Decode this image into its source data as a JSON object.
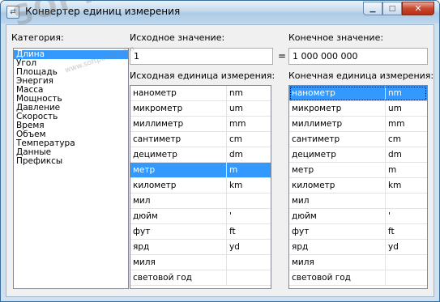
{
  "window": {
    "title": "Конвертер единиц измерения",
    "icon": "converter-app-icon",
    "minimize_glyph": "▁",
    "maximize_glyph": "□",
    "close_glyph": "✕"
  },
  "labels": {
    "category": "Категория:",
    "source_value": "Исходное значение:",
    "result_value": "Конечное значение:",
    "source_unit": "Исходная единица измерения:",
    "target_unit": "Конечная единица измерения:",
    "equals": "="
  },
  "inputs": {
    "source_value": "1",
    "result_value": "1 000 000 000"
  },
  "categories": [
    "Длина",
    "Угол",
    "Площадь",
    "Энергия",
    "Масса",
    "Мощность",
    "Давление",
    "Скорость",
    "Время",
    "Объем",
    "Температура",
    "Данные",
    "Префиксы"
  ],
  "selected_category": "Длина",
  "units": [
    {
      "name": "нанометр",
      "abbr": "nm"
    },
    {
      "name": "микрометр",
      "abbr": "um"
    },
    {
      "name": "миллиметр",
      "abbr": "mm"
    },
    {
      "name": "сантиметр",
      "abbr": "cm"
    },
    {
      "name": "дециметр",
      "abbr": "dm"
    },
    {
      "name": "метр",
      "abbr": "m"
    },
    {
      "name": "километр",
      "abbr": "km"
    },
    {
      "name": "мил",
      "abbr": ""
    },
    {
      "name": "дюйм",
      "abbr": "'"
    },
    {
      "name": "фут",
      "abbr": "ft"
    },
    {
      "name": "ярд",
      "abbr": "yd"
    },
    {
      "name": "миля",
      "abbr": ""
    },
    {
      "name": "световой год",
      "abbr": ""
    }
  ],
  "selected_source_unit": "метр",
  "selected_target_unit": "нанометр",
  "watermark": {
    "logo_text": "SOFTPORTAL",
    "url_text": "www.softportal.com"
  },
  "colors": {
    "selection": "#3399ff",
    "titlebar": "#bcd6ec",
    "close_button": "#c9462c"
  }
}
